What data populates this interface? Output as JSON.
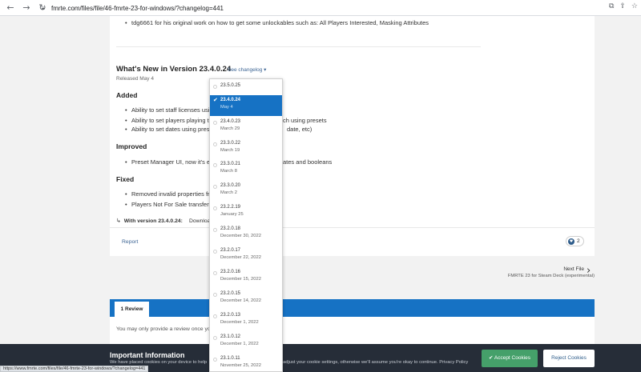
{
  "browser": {
    "url": "fmrte.com/files/file/46-fmrte-23-for-windows/?changelog=441",
    "back_icon": "arrow-left-icon",
    "forward_icon": "arrow-right-icon",
    "reload_icon": "reload-icon"
  },
  "content": {
    "credit_text": "tdg6661 for his original work on how to get some unlockables such as: All Players Interested, Masking Attributes",
    "version_title": "What's New in Version 23.4.0.24",
    "see_changelog": "See changelog ▾",
    "released": "Released May 4",
    "added_heading": "Added",
    "added_items": [
      "Ability to set staff licenses usi",
      "Ability to set players playing ti",
      "Ability to set dates using prese"
    ],
    "added_tails": [
      "",
      "ch using presets",
      "date, etc)"
    ],
    "improved_heading": "Improved",
    "improved_items": [
      "Preset Manager UI, now it's ea"
    ],
    "improved_tails": [
      "ates and booleans"
    ],
    "fixed_heading": "Fixed",
    "fixed_items": [
      "Removed invalid properties fro",
      "Players Not For Sale transfer s"
    ],
    "with_version_prefix": "↳",
    "with_version": "With version 23.4.0.24:",
    "download": "Download",
    "report": "Report",
    "reaction_count": "2"
  },
  "next_file": {
    "label": "Next File",
    "name": "FMRTE 23 for Steam Deck (experimental)"
  },
  "reviews": {
    "tab_label": "1 Review",
    "note": "You may only provide a review once you"
  },
  "cookie": {
    "title": "Important Information",
    "text_left": "We have placed cookies on your device to help",
    "text_right": "adjust your cookie settings, otherwise we'll assume you're okay to continue. Privacy Policy",
    "accept": "✔ Accept Cookies",
    "reject": "Reject Cookies"
  },
  "status_url": "https://www.fmrte.com/files/file/46-fmrte-23-for-windows/?changelog=441",
  "dropdown": {
    "items": [
      {
        "version": "23.5.0.25",
        "date": ""
      },
      {
        "version": "23.4.0.24",
        "date": "May 4"
      },
      {
        "version": "23.4.0.23",
        "date": "March 29"
      },
      {
        "version": "23.3.0.22",
        "date": "March 19"
      },
      {
        "version": "23.3.0.21",
        "date": "March 8"
      },
      {
        "version": "23.3.0.20",
        "date": "March 2"
      },
      {
        "version": "23.2.2.19",
        "date": "January 25"
      },
      {
        "version": "23.2.0.18",
        "date": "December 30, 2022"
      },
      {
        "version": "23.2.0.17",
        "date": "December 22, 2022"
      },
      {
        "version": "23.2.0.16",
        "date": "December 15, 2022"
      },
      {
        "version": "23.2.0.15",
        "date": "December 14, 2022"
      },
      {
        "version": "23.2.0.13",
        "date": "December 1, 2022"
      },
      {
        "version": "23.1.0.12",
        "date": "December 1, 2022"
      },
      {
        "version": "23.1.0.11",
        "date": "November 25, 2022"
      }
    ],
    "selected_index": 1
  },
  "colors": {
    "accent_blue": "#1672c4",
    "accept_green": "#45a06a",
    "banner_dark": "#262d38",
    "link_blue": "#3d6594"
  }
}
